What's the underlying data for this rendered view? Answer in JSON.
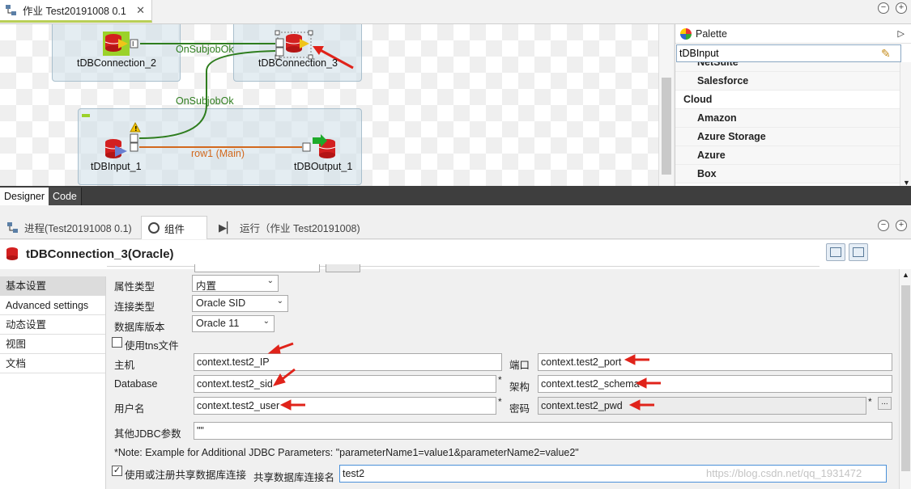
{
  "job_tab": {
    "title": "作业 Test20191008 0.1"
  },
  "canvas": {
    "components": {
      "db_connection_2": "tDBConnection_2",
      "db_connection_3": "tDBConnection_3",
      "db_input_1": "tDBInput_1",
      "db_output_1": "tDBOutput_1"
    },
    "links": {
      "onsubjob_top": "OnSubjobOk",
      "onsubjob_mid": "OnSubjobOk",
      "main_row": "row1 (Main)"
    }
  },
  "palette": {
    "title": "Palette",
    "search_value": "tDBInput",
    "items": [
      {
        "label": "NetSuite",
        "kind": "sub"
      },
      {
        "label": "Salesforce",
        "kind": "sub"
      },
      {
        "label": "Cloud",
        "kind": "cat"
      },
      {
        "label": "Amazon",
        "kind": "sub"
      },
      {
        "label": "Azure Storage",
        "kind": "sub"
      },
      {
        "label": "Azure",
        "kind": "sub"
      },
      {
        "label": "Box",
        "kind": "sub"
      }
    ]
  },
  "editor_tabs": {
    "designer": "Designer",
    "code": "Code"
  },
  "view_tabs": {
    "process": "进程(Test20191008 0.1)",
    "component": "组件",
    "run": "运行（作业 Test20191008)"
  },
  "component": {
    "title": "tDBConnection_3(Oracle)"
  },
  "leftnav": {
    "items": [
      "基本设置",
      "Advanced settings",
      "动态设置",
      "视图",
      "文档"
    ]
  },
  "form": {
    "property_type": {
      "label": "属性类型",
      "value": "内置"
    },
    "connection_type": {
      "label": "连接类型",
      "value": "Oracle SID"
    },
    "db_version": {
      "label": "数据库版本",
      "value": "Oracle 11"
    },
    "use_tns": {
      "label": "使用tns文件"
    },
    "host": {
      "label": "主机",
      "value": "context.test2_IP"
    },
    "port": {
      "label": "端口",
      "value": "context.test2_port"
    },
    "database": {
      "label": "Database",
      "value": "context.test2_sid"
    },
    "schema": {
      "label": "架构",
      "value": "context.test2_schema"
    },
    "user": {
      "label": "用户名",
      "value": "context.test2_user"
    },
    "password": {
      "label": "密码",
      "value": "context.test2_pwd"
    },
    "jdbc_params": {
      "label": "其他JDBC参数",
      "value": "\"\""
    },
    "note": "*Note: Example for Additional JDBC Parameters: \"parameterName1=value1&parameterName2=value2\"",
    "shared_conn": {
      "label": "使用或注册共享数据库连接",
      "checked": true
    },
    "shared_name": {
      "label": "共享数据库连接名",
      "value": "test2"
    },
    "required_mark": "*",
    "ellipsis": "..."
  },
  "watermark": "https://blog.csdn.net/qq_1931472",
  "colors": {
    "link_green": "#2e7d1e",
    "link_orange": "#d2691e",
    "arrow_red": "#e0231a",
    "tab_accent": "#b9cf57"
  }
}
